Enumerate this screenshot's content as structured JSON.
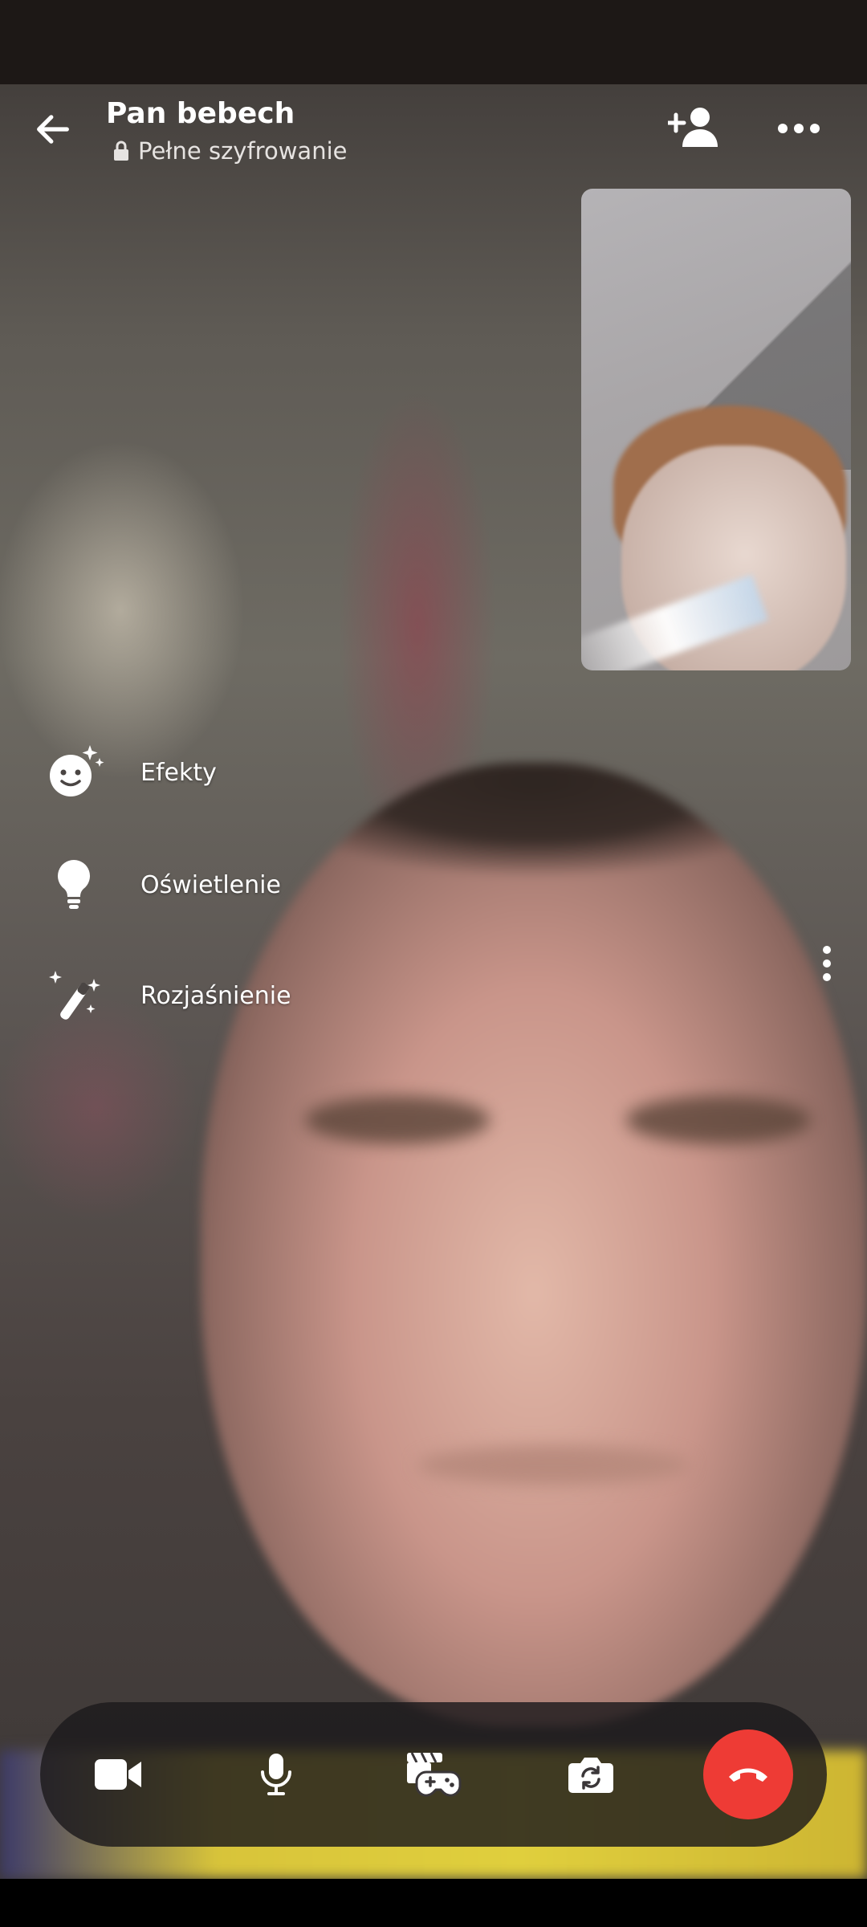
{
  "header": {
    "title": "Pan bebech",
    "subtitle": "Pełne szyfrowanie"
  },
  "effects_menu": [
    {
      "label": "Efekty",
      "icon": "face-sparkle-icon"
    },
    {
      "label": "Oświetlenie",
      "icon": "lightbulb-icon"
    },
    {
      "label": "Rozjaśnienie",
      "icon": "magic-wand-icon"
    }
  ],
  "controls": [
    {
      "name": "camera-toggle",
      "icon": "video-camera-icon"
    },
    {
      "name": "mic-toggle",
      "icon": "microphone-icon"
    },
    {
      "name": "games",
      "icon": "game-controller-icon"
    },
    {
      "name": "flip-camera",
      "icon": "camera-flip-icon"
    },
    {
      "name": "end-call",
      "icon": "hang-up-icon",
      "color": "#ee3b35"
    }
  ]
}
